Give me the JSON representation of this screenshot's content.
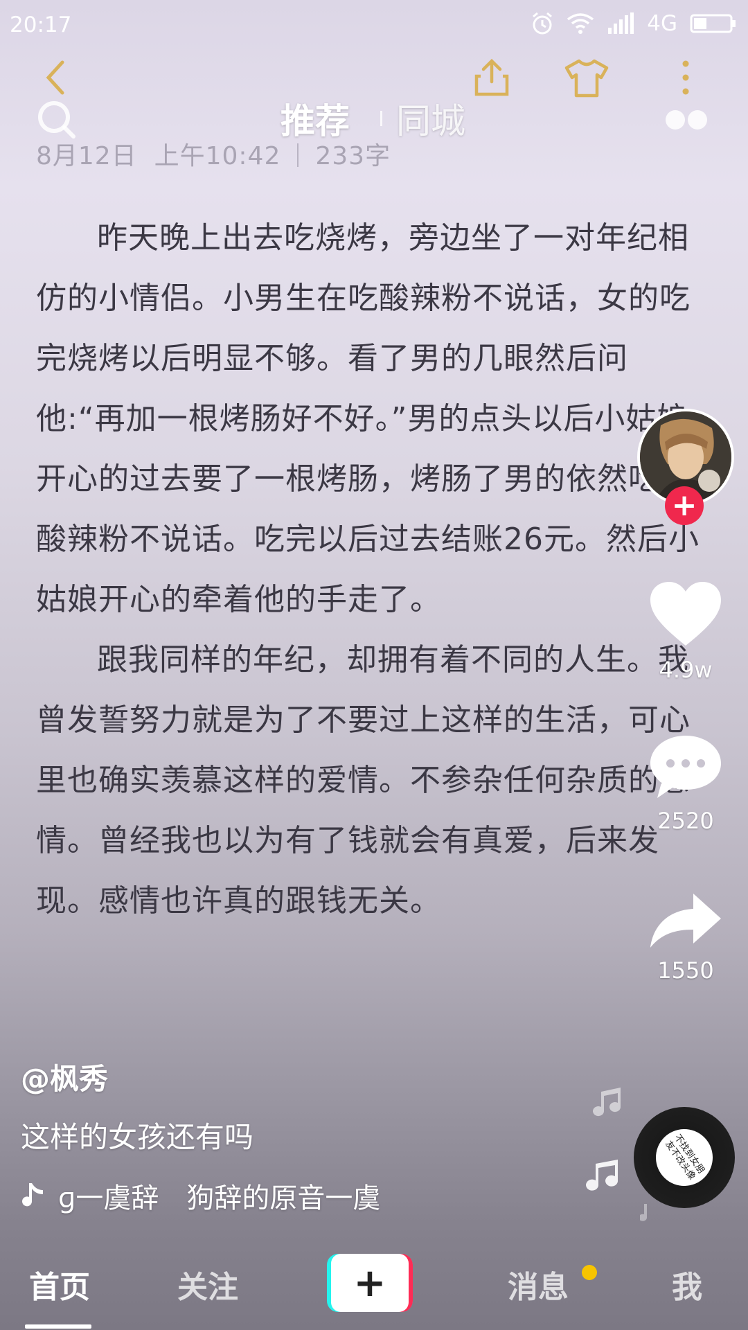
{
  "status_bar": {
    "time": "20:17",
    "network": "4G",
    "icons": [
      "alarm-icon",
      "wifi-icon",
      "signal-icon",
      "battery-icon"
    ]
  },
  "note": {
    "date": "8月12日",
    "time": "上午10:42",
    "word_count": "233字",
    "paragraphs": [
      "昨天晚上出去吃烧烤，旁边坐了一对年纪相仿的小情侣。小男生在吃酸辣粉不说话，女的吃完烧烤以后明显不够。看了男的几眼然后问他:“再加一根烤肠好不好。”男的点头以后小姑娘开心的过去要了一根烤肠，烤肠了男的依然吃着酸辣粉不说话。吃完以后过去结账26元。然后小姑娘开心的牵着他的手走了。",
      "跟我同样的年纪，却拥有着不同的人生。我曾发誓努力就是为了不要过上这样的生活，可心里也确实羡慕这样的爱情。不参杂任何杂质的感情。曾经我也以为有了钱就会有真爱，后来发现。感情也许真的跟钱无关。"
    ],
    "header_icons": [
      "back-icon",
      "share-icon",
      "tshirt-icon",
      "more-icon"
    ]
  },
  "feed_tabs": {
    "recommend": "推荐",
    "nearby": "同城"
  },
  "video": {
    "author": "@枫秀",
    "caption": "这样的女孩还有吗",
    "music": "ɡ一虞辞　狗辞的原音一虞",
    "record_label": "不找到女朋友不改头像",
    "likes": "4.9w",
    "comments": "2520",
    "shares": "1550"
  },
  "bottom_nav": {
    "home": "首页",
    "follow": "关注",
    "messages": "消息",
    "me": "我",
    "create": "+"
  },
  "colors": {
    "follow_plus": "#f0284d",
    "message_dot": "#f7c400",
    "create_cyan": "#25f4ee",
    "create_red": "#fe2c55"
  }
}
